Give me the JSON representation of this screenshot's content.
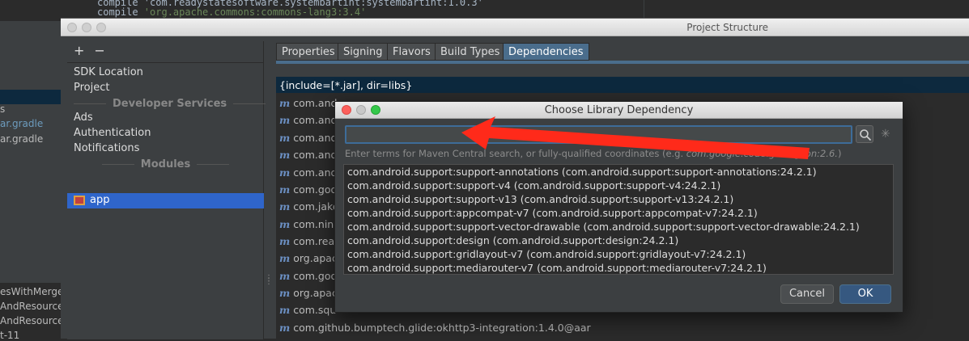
{
  "editor": {
    "line1": "compile 'com.readystatesoftware.systembartint:systembartint:1.0.3'",
    "line2_prefix": "compile ",
    "line2_string": "'org.apache.commons:commons-lang3:3.4'"
  },
  "left_panel": {
    "items": [
      "s",
      "ar.gradle",
      "ar.gradle"
    ],
    "bottom_items": [
      "esWithMerge",
      "AndResource",
      "AndResource",
      "t-11"
    ]
  },
  "project_structure": {
    "title": "Project Structure",
    "side": {
      "add": "+",
      "remove": "−",
      "top_items": [
        "SDK Location",
        "Project"
      ],
      "developer_services_header": "Developer Services",
      "service_items": [
        "Ads",
        "Authentication",
        "Notifications"
      ],
      "modules_header": "Modules",
      "module_app": "app"
    },
    "tabs": [
      "Properties",
      "Signing",
      "Flavors",
      "Build Types",
      "Dependencies"
    ],
    "active_tab": "Dependencies",
    "dependencies": [
      "{include=[*.jar], dir=libs}",
      "com.andr",
      "com.andr",
      "com.andr",
      "com.andr",
      "com.andr",
      "com.goo",
      "com.jake",
      "com.nine",
      "com.read",
      "org.apac",
      "com.goo",
      "org.apac",
      "com.squ",
      "com.github.bumptech.glide:okhttp3-integration:1.4.0@aar"
    ],
    "dep_icon": "m"
  },
  "dialog": {
    "title": "Choose Library Dependency",
    "search_value": "",
    "hint_prefix": "Enter terms for Maven Central search, or fully-qualified coordinates (e.g. ",
    "hint_example": "com.google.code.gson:gson:2.6.",
    "hint_suffix": ")",
    "results": [
      "com.android.support:support-annotations (com.android.support:support-annotations:24.2.1)",
      "com.android.support:support-v4 (com.android.support:support-v4:24.2.1)",
      "com.android.support:support-v13 (com.android.support:support-v13:24.2.1)",
      "com.android.support:appcompat-v7 (com.android.support:appcompat-v7:24.2.1)",
      "com.android.support:support-vector-drawable (com.android.support:support-vector-drawable:24.2.1)",
      "com.android.support:design (com.android.support:design:24.2.1)",
      "com.android.support:gridlayout-v7 (com.android.support:gridlayout-v7:24.2.1)",
      "com.android.support:mediarouter-v7 (com.android.support:mediarouter-v7:24.2.1)"
    ],
    "cancel_label": "Cancel",
    "ok_label": "OK"
  },
  "colors": {
    "accent": "#4a6d8c",
    "selection": "#2f65ca",
    "annotation_arrow": "#ff2a1a"
  },
  "icons": [
    "search-icon",
    "spinner-icon",
    "maven-m-icon",
    "module-app-icon",
    "annotation-arrow"
  ]
}
